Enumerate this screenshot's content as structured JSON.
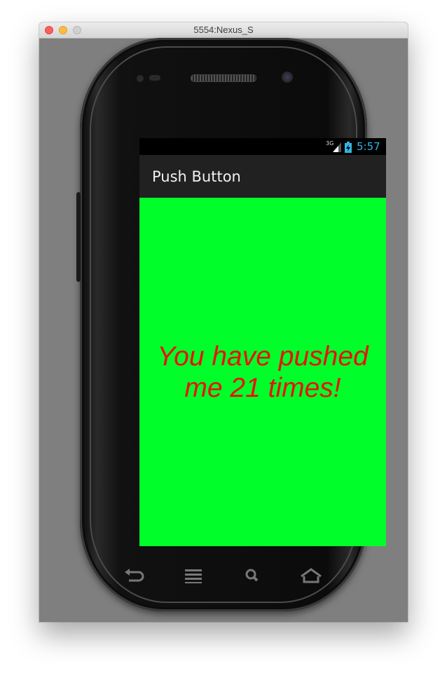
{
  "window": {
    "title": "5554:Nexus_S"
  },
  "status_bar": {
    "network": "3G",
    "time": "5:57"
  },
  "app": {
    "title": "Push Button",
    "message": "You have pushed me 21 times!",
    "background_color": "#00ff2a",
    "text_color": "#e8120c"
  },
  "nav_keys": [
    "back-icon",
    "menu-icon",
    "search-icon",
    "home-icon"
  ]
}
